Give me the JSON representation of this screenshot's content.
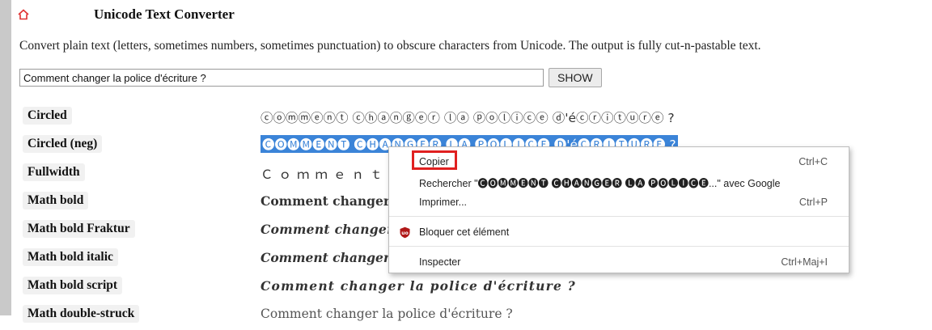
{
  "app": {
    "title": "Unicode Text Converter",
    "description": "Convert plain text (letters, sometimes numbers, sometimes punctuation) to obscure characters from Unicode. The output is fully cut-n-pastable text."
  },
  "input": {
    "value": "Comment changer la police d'écriture ?",
    "show_label": "SHOW"
  },
  "rows": [
    {
      "label": "Circled",
      "output": "ⓒⓞⓜⓜⓔⓝⓣ ⓒⓗⓐⓝⓖⓔⓡ ⓛⓐ ⓟⓞⓛⓘⓒⓔ ⓓ'éⓒⓡⓘⓣⓤⓡⓔ ?"
    },
    {
      "label": "Circled (neg)",
      "output": "🅒🅞🅜🅜🅔🅝🅣 🅒🅗🅐🅝🅖🅔🅡 🅛🅐 🅟🅞🅛🅘🅒🅔 🅓'é🅒🅡🅘🅣🅤🅡🅔 ?"
    },
    {
      "label": "Fullwidth",
      "output": "Ｃｏｍｍｅｎｔ ｃｈａｎｇｅｒ"
    },
    {
      "label": "Math bold",
      "output": "Comment changer la police d'écriture ?"
    },
    {
      "label": "Math bold Fraktur",
      "output": "Comment changer la police d'écriture ?"
    },
    {
      "label": "Math bold italic",
      "output": "Comment changer la police d'écriture ?"
    },
    {
      "label": "Math bold script",
      "output": "Comment changer la police d'écriture ?"
    },
    {
      "label": "Math double-struck",
      "output": "Comment changer la police d'écriture ?"
    }
  ],
  "context_menu": {
    "copy": {
      "label": "Copier",
      "shortcut": "Ctrl+C"
    },
    "search": {
      "label": "Rechercher \"🅒🅞🅜🅜🅔🅝🅣 🅒🅗🅐🅝🅖🅔🅡 🅛🅐 🅟🅞🅛🅘🅒🅔...\" avec Google"
    },
    "print": {
      "label": "Imprimer...",
      "shortcut": "Ctrl+P"
    },
    "block": {
      "label": "Bloquer cet élément",
      "icon": "ublock-icon"
    },
    "inspect": {
      "label": "Inspecter",
      "shortcut": "Ctrl+Maj+I"
    }
  },
  "colors": {
    "selection": "#3b84d8",
    "highlight_box": "#e02020",
    "home_icon": "#e03030",
    "ublock_icon": "#b01818"
  }
}
